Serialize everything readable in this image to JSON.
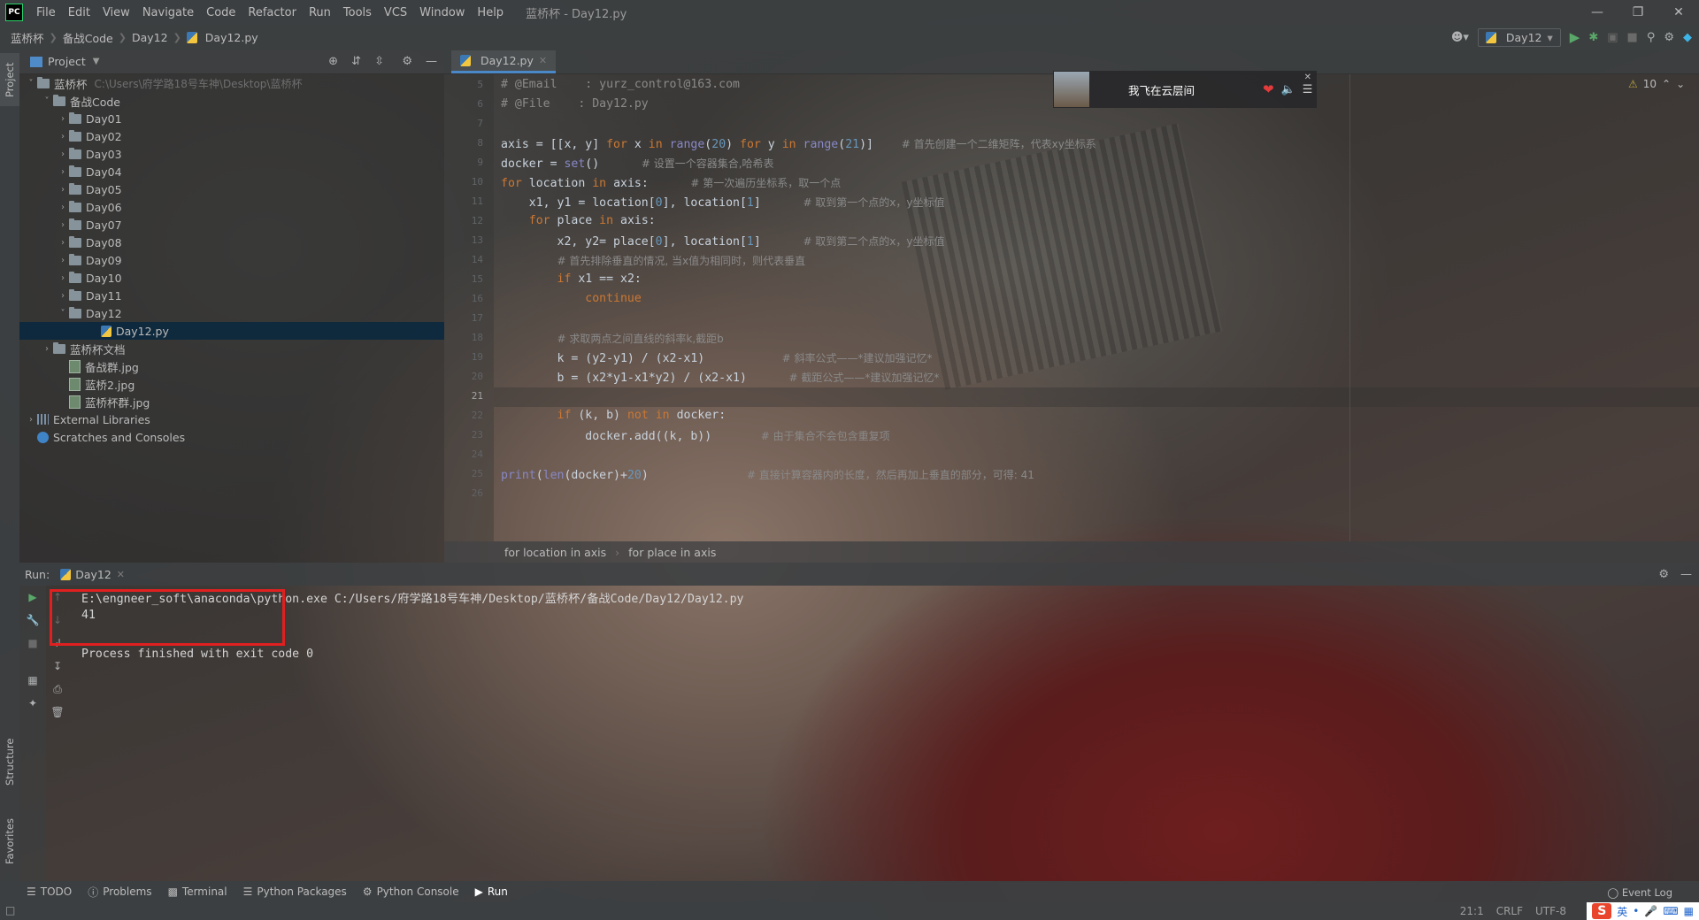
{
  "title_bar": {
    "app_logo": "PC",
    "menu": [
      "File",
      "Edit",
      "View",
      "Navigate",
      "Code",
      "Refactor",
      "Run",
      "Tools",
      "VCS",
      "Window",
      "Help"
    ],
    "window_title": "蓝桥杯 - Day12.py"
  },
  "nav_bar": {
    "crumbs": [
      "蓝桥杯",
      "备战Code",
      "Day12",
      "Day12.py"
    ],
    "run_config": "Day12"
  },
  "project": {
    "header": "Project",
    "tree": [
      {
        "label": "蓝桥杯",
        "path": "C:\\Users\\府学路18号车神\\Desktop\\蓝桥杯",
        "kind": "folder",
        "depth": 0,
        "open": true
      },
      {
        "label": "备战Code",
        "kind": "folder",
        "depth": 1,
        "open": true
      },
      {
        "label": "Day01",
        "kind": "folder",
        "depth": 2
      },
      {
        "label": "Day02",
        "kind": "folder",
        "depth": 2
      },
      {
        "label": "Day03",
        "kind": "folder",
        "depth": 2
      },
      {
        "label": "Day04",
        "kind": "folder",
        "depth": 2
      },
      {
        "label": "Day05",
        "kind": "folder",
        "depth": 2
      },
      {
        "label": "Day06",
        "kind": "folder",
        "depth": 2
      },
      {
        "label": "Day07",
        "kind": "folder",
        "depth": 2
      },
      {
        "label": "Day08",
        "kind": "folder",
        "depth": 2
      },
      {
        "label": "Day09",
        "kind": "folder",
        "depth": 2
      },
      {
        "label": "Day10",
        "kind": "folder",
        "depth": 2
      },
      {
        "label": "Day11",
        "kind": "folder",
        "depth": 2
      },
      {
        "label": "Day12",
        "kind": "folder",
        "depth": 2,
        "open": true
      },
      {
        "label": "Day12.py",
        "kind": "py",
        "depth": 4,
        "selected": true
      },
      {
        "label": "蓝桥杯文档",
        "kind": "folder",
        "depth": 1
      },
      {
        "label": "备战群.jpg",
        "kind": "img",
        "depth": 2
      },
      {
        "label": "蓝桥2.jpg",
        "kind": "img",
        "depth": 2
      },
      {
        "label": "蓝桥杯群.jpg",
        "kind": "img",
        "depth": 2
      },
      {
        "label": "External Libraries",
        "kind": "lib",
        "depth": 0
      },
      {
        "label": "Scratches and Consoles",
        "kind": "scratch",
        "depth": 0
      }
    ]
  },
  "left_strip": {
    "project": "Project",
    "structure": "Structure",
    "favorites": "Favorites"
  },
  "editor": {
    "tab": "Day12.py",
    "inspections": "10",
    "line_numbers": [
      "5",
      "6",
      "7",
      "8",
      "9",
      "10",
      "11",
      "12",
      "13",
      "14",
      "15",
      "16",
      "17",
      "18",
      "19",
      "20",
      "21",
      "22",
      "23",
      "24",
      "25",
      "26"
    ],
    "lines": [
      "# @Email    : yurz_control@163.com",
      "# @File    : Day12.py",
      "",
      "axis = [[x, y] for x in range(20) for y in range(21)]    # 首先创建一个二维矩阵，代表xy坐标系",
      "docker = set()      # 设置一个容器集合,哈希表",
      "for location in axis:      # 第一次遍历坐标系，取一个点",
      "    x1, y1 = location[0], location[1]      # 取到第一个点的x，y坐标值",
      "    for place in axis:",
      "        x2, y2= place[0], location[1]      # 取到第二个点的x，y坐标值",
      "        # 首先排除垂直的情况, 当x值为相同时，则代表垂直",
      "        if x1 == x2:",
      "            continue",
      "",
      "        # 求取两点之间直线的斜率k,截距b",
      "        k = (y2-y1) / (x2-x1)           # 斜率公式——*建议加强记忆*",
      "        b = (x2*y1-x1*y2) / (x2-x1)      # 截距公式——*建议加强记忆*",
      "",
      "        if (k, b) not in docker:",
      "            docker.add((k, b))       # 由于集合不会包含重复项",
      "",
      "print(len(docker)+20)              # 直接计算容器内的长度，然后再加上垂直的部分，可得: 41",
      ""
    ],
    "breadcrumb": [
      "for location in axis",
      "for place in axis"
    ]
  },
  "music_widget": {
    "song": "我飞在云层间"
  },
  "run": {
    "label": "Run:",
    "tab": "Day12",
    "console": [
      "E:\\engneer_soft\\anaconda\\python.exe C:/Users/府学路18号车神/Desktop/蓝桥杯/备战Code/Day12/Day12.py",
      "41",
      "",
      "Process finished with exit code 0"
    ]
  },
  "bottom_tabs": [
    "TODO",
    "Problems",
    "Terminal",
    "Python Packages",
    "Python Console",
    "Run"
  ],
  "status": {
    "position": "21:1",
    "line_sep": "CRLF",
    "encoding": "UTF-8",
    "event_log": "Event Log",
    "ime_lang": "英"
  }
}
